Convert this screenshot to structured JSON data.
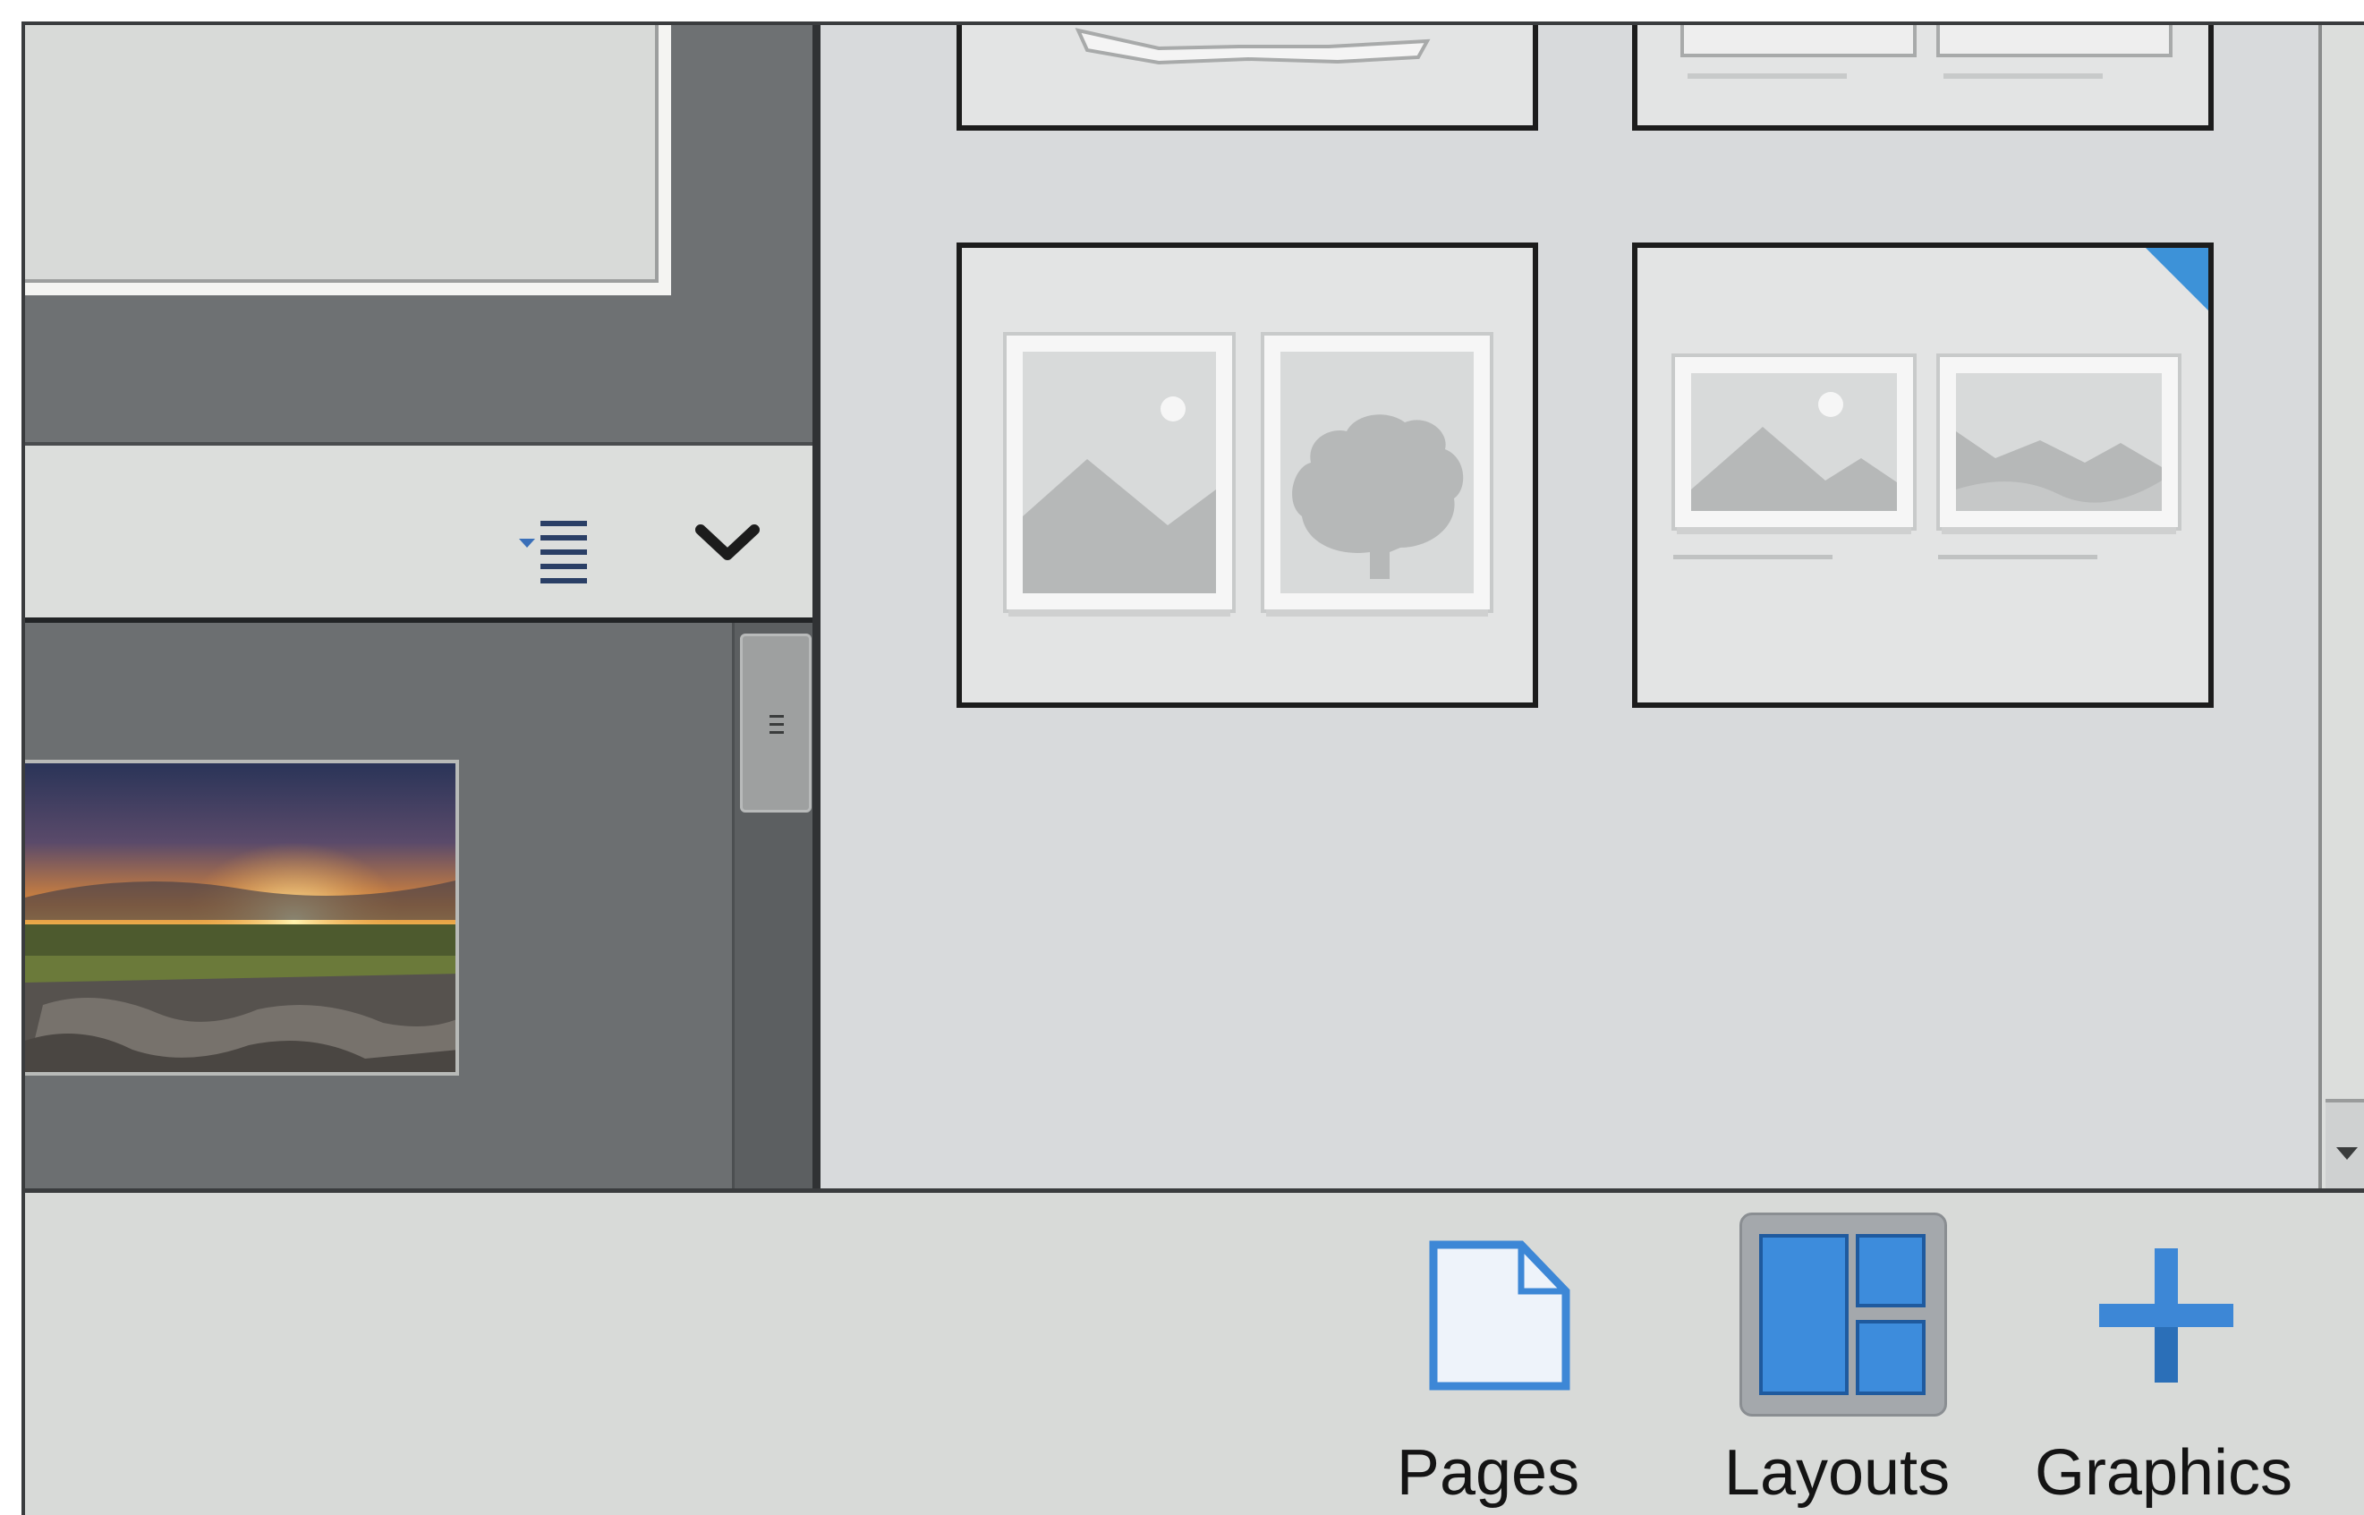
{
  "toolbar": {
    "pages_label": "Pages",
    "layouts_label": "Layouts",
    "graphics_label": "Graphics",
    "active_tool": "Layouts"
  },
  "icons": {
    "sort": "sort-list-icon",
    "collapse": "chevron-down-icon",
    "pages": "page-icon",
    "layouts": "layout-grid-icon",
    "graphics": "plus-icon",
    "scroll_down": "arrow-down-icon"
  },
  "colors": {
    "accent": "#3d92d8",
    "panel_dark": "#6e7173",
    "panel_light": "#d8dadc",
    "toolbar_bg": "#d8dad8"
  },
  "layouts": [
    {
      "id": "layout-partial-1",
      "type": "collage"
    },
    {
      "id": "layout-partial-2",
      "type": "two-photos-captions"
    },
    {
      "id": "layout-two-photos",
      "type": "two-photos"
    },
    {
      "id": "layout-two-photos-captions",
      "type": "two-photos-captions",
      "badge": true
    }
  ]
}
